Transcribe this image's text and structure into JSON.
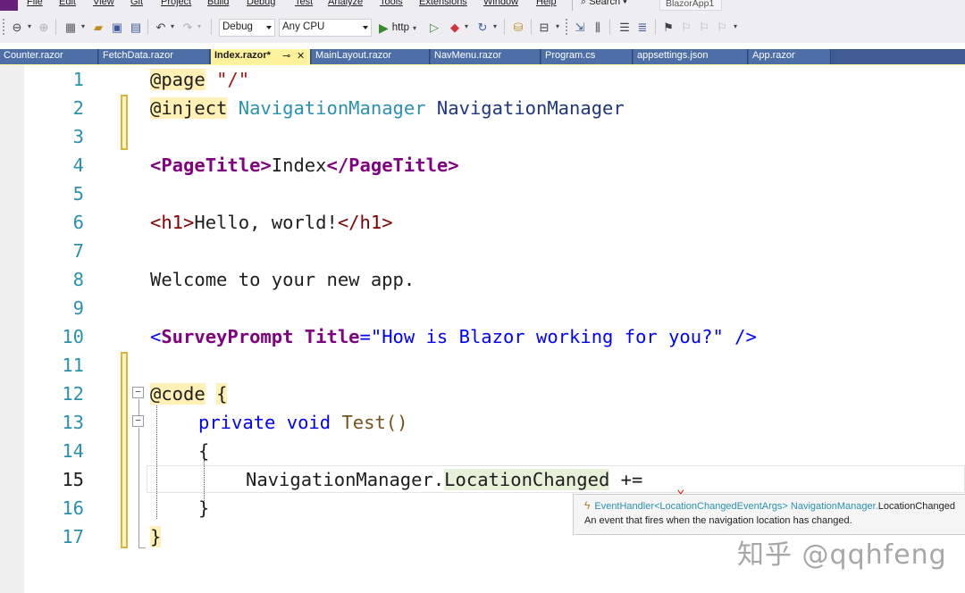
{
  "menu": {
    "items": [
      "File",
      "Edit",
      "View",
      "Git",
      "Project",
      "Build",
      "Debug",
      "Test",
      "Analyze",
      "Tools",
      "Extensions",
      "Window",
      "Help"
    ],
    "search_label": "Search",
    "project_name": "BlazorApp1"
  },
  "toolbar": {
    "config_value": "Debug",
    "platform_value": "Any CPU",
    "run_label": "http"
  },
  "tabs": [
    {
      "label": "Counter.razor",
      "active": false
    },
    {
      "label": "FetchData.razor",
      "active": false
    },
    {
      "label": "Index.razor*",
      "active": true
    },
    {
      "label": "MainLayout.razor",
      "active": false
    },
    {
      "label": "NavMenu.razor",
      "active": false
    },
    {
      "label": "Program.cs",
      "active": false
    },
    {
      "label": "appsettings.json",
      "active": false
    },
    {
      "label": "App.razor",
      "active": false
    }
  ],
  "editor": {
    "line_numbers": [
      "1",
      "2",
      "3",
      "4",
      "5",
      "6",
      "7",
      "8",
      "9",
      "10",
      "11",
      "12",
      "13",
      "14",
      "15",
      "16",
      "17"
    ],
    "current_line": "15",
    "lines": {
      "l1": {
        "directive": "@page",
        "value": "\"/\""
      },
      "l2": {
        "directive": "@inject",
        "type": "NavigationManager",
        "name": "NavigationManager"
      },
      "l4": {
        "open": "<PageTitle>",
        "text": "Index",
        "close": "</PageTitle>"
      },
      "l6": {
        "open": "<h1>",
        "text": "Hello, world!",
        "close": "</h1>"
      },
      "l8": {
        "text": "Welcome to your new app."
      },
      "l10": {
        "open": "<",
        "component": "SurveyPrompt",
        "attr": "Title",
        "eq": "=",
        "value": "\"How is Blazor working for you?\"",
        "close": " />"
      },
      "l12": {
        "directive": "@code",
        "brace": "{"
      },
      "l13": {
        "kw1": "private",
        "kw2": "void",
        "name": "Test()"
      },
      "l14": {
        "brace": "{"
      },
      "l15": {
        "obj": "NavigationManager.",
        "member": "LocationChanged",
        "op": "+="
      },
      "l16": {
        "brace": "}"
      },
      "l17": {
        "brace": "}"
      }
    }
  },
  "tooltip": {
    "signature_type": "EventHandler<LocationChangedEventArgs>",
    "signature_class": "NavigationManager.",
    "signature_member": "LocationChanged",
    "description": "An event that fires when the navigation location has changed."
  },
  "watermark": "知乎 @qqhfeng",
  "colors": {
    "accent": "#68217a",
    "tab_bar": "#3f5b8f",
    "active_tab": "#fff29d",
    "line_number": "#2b91af",
    "keyword": "#0000ff",
    "razor_highlight": "#fff1b5"
  }
}
